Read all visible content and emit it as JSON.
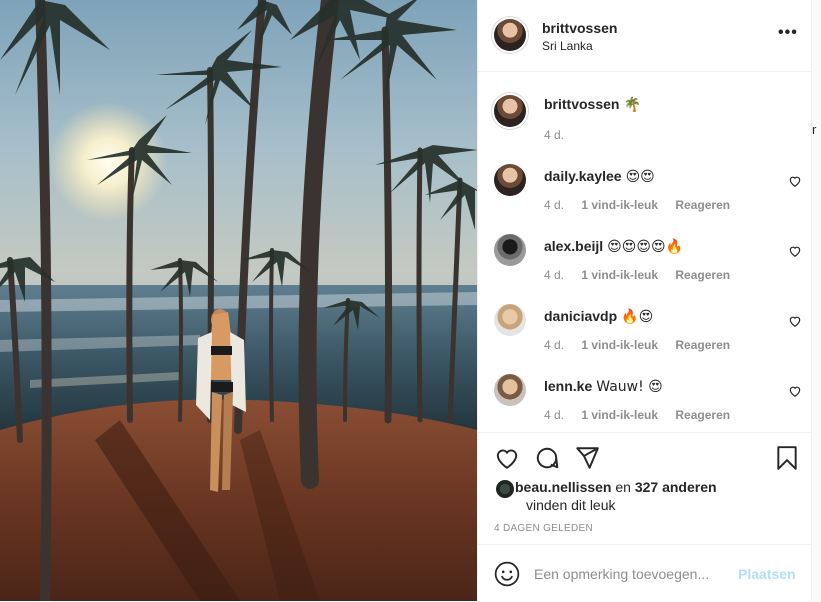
{
  "post": {
    "username": "brittvossen",
    "location": "Sri Lanka",
    "caption": {
      "username": "brittvossen",
      "text": "🌴",
      "age": "4 d."
    },
    "comments": [
      {
        "username": "daily.kaylee",
        "text": "😍😍",
        "age": "4 d.",
        "likes": "1 vind-ik-leuk",
        "reply": "Reageren"
      },
      {
        "username": "alex.beijl",
        "text": "😍😍😍😍🔥",
        "age": "4 d.",
        "likes": "1 vind-ik-leuk",
        "reply": "Reageren"
      },
      {
        "username": "daniciavdp",
        "text": "🔥😍",
        "age": "4 d.",
        "likes": "1 vind-ik-leuk",
        "reply": "Reageren"
      },
      {
        "username": "lenn.ke",
        "text": "Wauw! 😍",
        "age": "4 d.",
        "likes": "1 vind-ik-leuk",
        "reply": "Reageren"
      }
    ],
    "likes": {
      "liker": "beau.nellissen",
      "connector": "en",
      "others": "327 anderen",
      "suffix": "vinden dit leuk"
    },
    "timestamp": "4 DAGEN GELEDEN",
    "comment_input": {
      "placeholder": "Een opmerking toevoegen...",
      "post_label": "Plaatsen"
    }
  },
  "side": {
    "partial_text": "r"
  },
  "icons": [
    "more-options-icon",
    "heart-icon",
    "comment-icon",
    "share-icon",
    "bookmark-icon",
    "emoji-icon"
  ],
  "colors": {
    "post_button": "#b2dffc",
    "muted": "#8e8e8e",
    "text": "#262626",
    "border": "#efefef"
  }
}
